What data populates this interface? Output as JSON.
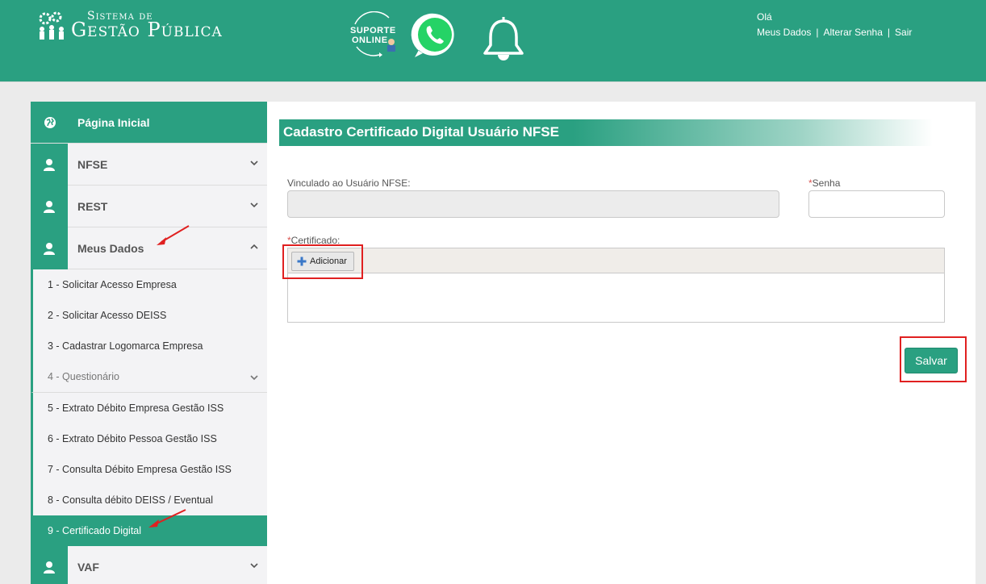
{
  "header": {
    "logo_line1": "Sistema de",
    "logo_line2": "Gestão Pública",
    "suporte_line1": "SUPORTE",
    "suporte_line2": "ONLINE",
    "greeting": "Olá",
    "links": [
      "Meus Dados",
      "Alterar Senha",
      "Sair"
    ],
    "separator": "|"
  },
  "sidebar": {
    "home": "Página Inicial",
    "sections": [
      {
        "label": "NFSE"
      },
      {
        "label": "REST"
      },
      {
        "label": "Meus Dados"
      }
    ],
    "sub_items": [
      "1 - Solicitar Acesso Empresa",
      "2 - Solicitar Acesso DEISS",
      "3 - Cadastrar Logomarca Empresa",
      "4 - Questionário",
      "5 - Extrato Débito Empresa Gestão ISS",
      "6 - Extrato Débito Pessoa Gestão ISS",
      "7 - Consulta Débito Empresa Gestão ISS",
      "8 - Consulta débito DEISS / Eventual",
      "9 - Certificado Digital"
    ],
    "last_section": "VAF"
  },
  "main": {
    "title": "Cadastro Certificado Digital Usuário NFSE",
    "vinculado_label": "Vinculado ao Usuário NFSE:",
    "vinculado_value": "",
    "required_mark": "*",
    "senha_label": "Senha",
    "certificado_label": "Certificado:",
    "add_button": "Adicionar",
    "save_button": "Salvar"
  },
  "colors": {
    "primary": "#2aa081",
    "highlight": "#e02020"
  }
}
